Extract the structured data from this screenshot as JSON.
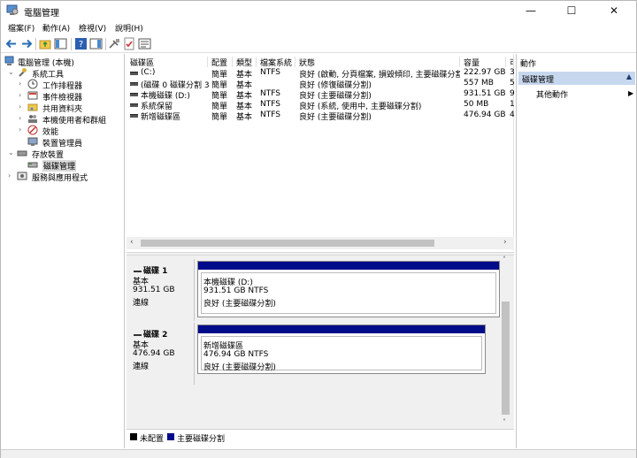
{
  "window": {
    "title": "電腦管理",
    "controls": {
      "minimize": "—",
      "maximize": "☐",
      "close": "✕"
    }
  },
  "menu": [
    "檔案(F)",
    "動作(A)",
    "檢視(V)",
    "說明(H)"
  ],
  "tree": {
    "items": [
      {
        "label": "電腦管理 (本機)",
        "expander": "",
        "icon": "computer-management-icon"
      },
      {
        "label": "系統工具",
        "expander": "⌄",
        "icon": "tools-icon"
      },
      {
        "label": "工作排程器",
        "expander": "›",
        "icon": "clock-icon"
      },
      {
        "label": "事件檢視器",
        "expander": "›",
        "icon": "event-viewer-icon"
      },
      {
        "label": "共用資料夾",
        "expander": "›",
        "icon": "shared-folder-icon"
      },
      {
        "label": "本機使用者和群組",
        "expander": "›",
        "icon": "users-icon"
      },
      {
        "label": "效能",
        "expander": "›",
        "icon": "performance-icon"
      },
      {
        "label": "裝置管理員",
        "expander": "",
        "icon": "device-manager-icon"
      },
      {
        "label": "存放裝置",
        "expander": "⌄",
        "icon": "storage-icon"
      },
      {
        "label": "磁碟管理",
        "expander": "",
        "icon": "disk-management-icon"
      },
      {
        "label": "服務與應用程式",
        "expander": "›",
        "icon": "services-icon"
      }
    ]
  },
  "volumes": {
    "headers": [
      "磁碟區",
      "配置",
      "類型",
      "檔案系統",
      "狀態",
      "容量",
      "可"
    ],
    "rows": [
      {
        "name": "(C:)",
        "layout": "簡單",
        "type": "基本",
        "fs": "NTFS",
        "status": "良好 (啟動, 分頁檔案, 損毀傾印, 主要磁碟分割)",
        "capacity": "222.97 GB",
        "free": "3"
      },
      {
        "name": "(磁碟 0 磁碟分割 3)",
        "layout": "簡單",
        "type": "基本",
        "fs": "",
        "status": "良好 (修復磁碟分割)",
        "capacity": "557 MB",
        "free": "5"
      },
      {
        "name": "本機磁碟 (D:)",
        "layout": "簡單",
        "type": "基本",
        "fs": "NTFS",
        "status": "良好 (主要磁碟分割)",
        "capacity": "931.51 GB",
        "free": "9"
      },
      {
        "name": "系統保留",
        "layout": "簡單",
        "type": "基本",
        "fs": "NTFS",
        "status": "良好 (系統, 使用中, 主要磁碟分割)",
        "capacity": "50 MB",
        "free": "1"
      },
      {
        "name": "新增磁碟區",
        "layout": "簡單",
        "type": "基本",
        "fs": "NTFS",
        "status": "良好 (主要磁碟分割)",
        "capacity": "476.94 GB",
        "free": "4"
      }
    ]
  },
  "disks": [
    {
      "name": "磁碟 1",
      "type": "基本",
      "size": "931.51 GB",
      "state": "連線",
      "partition": {
        "label": "本機磁碟 (D:)",
        "size": "931.51 GB NTFS",
        "status": "良好 (主要磁碟分割)"
      }
    },
    {
      "name": "磁碟 2",
      "type": "基本",
      "size": "476.94 GB",
      "state": "連線",
      "partition": {
        "label": "新增磁碟區",
        "size": "476.94 GB NTFS",
        "status": "良好 (主要磁碟分割)"
      }
    }
  ],
  "legend": [
    {
      "label": "未配置",
      "color": "#000000"
    },
    {
      "label": "主要磁碟分割",
      "color": "#000b8a"
    }
  ],
  "actions": {
    "header": "動作",
    "section": "磁碟管理",
    "item": "其他動作"
  }
}
